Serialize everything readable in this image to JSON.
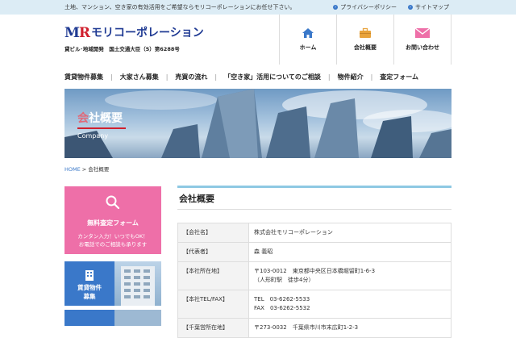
{
  "topbar": {
    "tagline": "土地、マンション、空き家の有効活用をご希望ならモリコーポレーションにお任せ下さい。",
    "links": [
      {
        "label": "プライバシーポリシー",
        "icon": "arrow-right-icon"
      },
      {
        "label": "サイトマップ",
        "icon": "arrow-right-icon"
      }
    ]
  },
  "logo": {
    "mark_m": "M",
    "mark_r": "R",
    "name": "モリコーポレーション",
    "sub": "貸ビル･地域開発　国土交通大臣（5）第6288号"
  },
  "header_nav": [
    {
      "label": "ホーム",
      "icon": "home-icon"
    },
    {
      "label": "会社概要",
      "icon": "briefcase-icon"
    },
    {
      "label": "お問い合わせ",
      "icon": "mail-icon"
    }
  ],
  "global_nav": [
    "賃貸物件募集",
    "大家さん募集",
    "売買の流れ",
    "「空き家」活用についてのご相談",
    "物件紹介",
    "査定フォーム"
  ],
  "hero": {
    "title_first": "会",
    "title_rest": "社概要",
    "subtitle": "Company"
  },
  "breadcrumb": {
    "home": "HOME",
    "sep": " > ",
    "current": "会社概要"
  },
  "side": {
    "form_title": "無料査定フォーム",
    "form_line1": "カンタン入力！いつでもOK！",
    "form_line2": "お電話でのご相談も承ります",
    "rent_label_1": "賃貸物件",
    "rent_label_2": "募集"
  },
  "main": {
    "title": "会社概要",
    "rows": [
      {
        "key": "【会社名】",
        "lines": [
          "株式会社モリコーポレーション"
        ]
      },
      {
        "key": "【代表者】",
        "lines": [
          "森 義昭"
        ]
      },
      {
        "key": "【本社所在地】",
        "lines": [
          "〒103-0012　東京都中央区日本橋堀留町1-6-3",
          "（人形町駅　徒歩4分）"
        ]
      },
      {
        "key": "【本社TEL/FAX】",
        "lines": [
          "TEL　03-6262-5533",
          "FAX　03-6262-5532"
        ]
      },
      {
        "key": "【千葉営所在地】",
        "lines": [
          "〒273-0032　千葉県市川市末広町1-2-3"
        ]
      }
    ]
  },
  "colors": {
    "accent_blue": "#3a78c9",
    "brand_navy": "#1f3a93",
    "brand_red": "#d0202e",
    "pink": "#ee6fa8",
    "topbar_bg": "#dcecf5"
  }
}
